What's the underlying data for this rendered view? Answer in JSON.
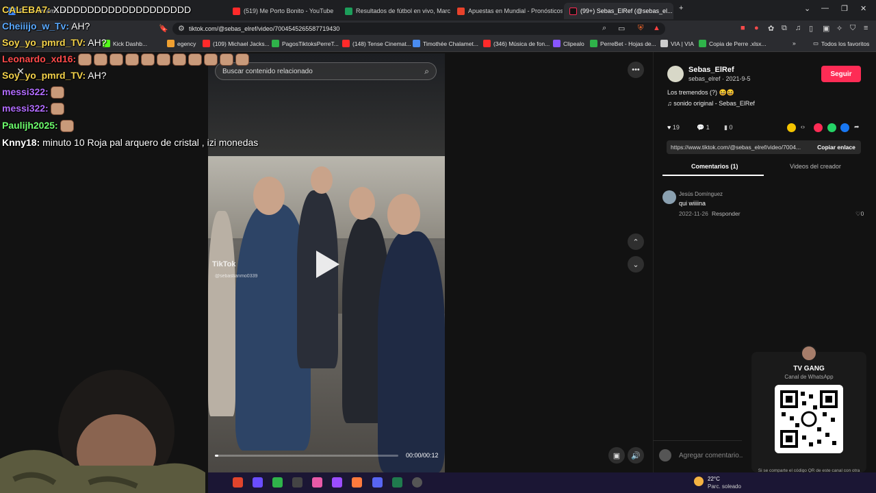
{
  "tabs": [
    {
      "label": "F... re streams Lc",
      "color": "#3f8cff"
    },
    {
      "label": "(519) Me Porto Bonito - YouTube",
      "color": "#ff2a2a"
    },
    {
      "label": "Resultados de fútbol en vivo, Marcad",
      "color": "#1c9e5a"
    },
    {
      "label": "Apuestas en Mundial - Pronósticos d",
      "color": "#e8422b"
    },
    {
      "label": "(99+) Sebas_ElRef (@sebas_el...",
      "color": "#ffffff"
    }
  ],
  "address": {
    "url": "tiktok.com/@sebas_elref/video/7004545265587719430"
  },
  "bookmarks": [
    {
      "label": "Kick Dashb...",
      "color": "#53fc18"
    },
    {
      "label": "egency",
      "color": "#f0a030"
    },
    {
      "label": "(109) Michael Jacks...",
      "color": "#ff2a2a"
    },
    {
      "label": "PagosTiktoksPerreT...",
      "color": "#2fb34a"
    },
    {
      "label": "(148) Tense Cinemat...",
      "color": "#ff2a2a"
    },
    {
      "label": "Timothée Chalamet...",
      "color": "#4a8cf0"
    },
    {
      "label": "(346) Música de fon...",
      "color": "#ff2a2a"
    },
    {
      "label": "Clipealo",
      "color": "#8855ff"
    },
    {
      "label": "PerreBet - Hojas de...",
      "color": "#2fb34a"
    },
    {
      "label": "VIA | VIA",
      "color": "#cccccc"
    },
    {
      "label": "Copia de Perre .xlsx...",
      "color": "#2fb34a"
    },
    {
      "label": "Todos los favoritos",
      "color": "#cccccc"
    }
  ],
  "chat": [
    {
      "user": "CALEBA7:",
      "color": "#f3d24a",
      "msg": " XDDDDDDDDDDDDDDDDDDD",
      "emotes": 0
    },
    {
      "user": "Cheiiijo_w_Tv:",
      "color": "#5aa9ff",
      "msg": " AH?",
      "emotes": 0
    },
    {
      "user": "Soy_yo_pmrd_TV:",
      "color": "#f3d24a",
      "msg": " AH?",
      "emotes": 0
    },
    {
      "user": "Leonardo_xd16:",
      "color": "#ff4a4a",
      "msg": "",
      "emotes": 11
    },
    {
      "user": "Soy_yo_pmrd_TV:",
      "color": "#f3d24a",
      "msg": " AH?",
      "emotes": 0
    },
    {
      "user": "messi322:",
      "color": "#b26cff",
      "msg": "",
      "emotes": 1
    },
    {
      "user": "messi322:",
      "color": "#b26cff",
      "msg": "",
      "emotes": 1
    },
    {
      "user": "Paulijh2025:",
      "color": "#6dff6d",
      "msg": "",
      "emotes": 1
    },
    {
      "user": "Knny18:",
      "color": "#ffffff",
      "msg": " minuto 10 Roja pal arquero de cristal , izi monedas",
      "emotes": 0
    }
  ],
  "video": {
    "search_placeholder": "Buscar contenido relacionado",
    "watermark": "TikTok",
    "watermark_user": "@sebastianmo0339",
    "time": "00:00/00:12",
    "progress": 0.02
  },
  "creator": {
    "name": "Sebas_ElRef",
    "handle_date": "sebas_elref · 2021-9-5",
    "follow_label": "Seguir",
    "caption": "Los tremendos (?) 😆😆",
    "sound": "sonido original - Sebas_ElRef",
    "likes": "19",
    "comments": "1",
    "saves": "0",
    "link": "https://www.tiktok.com/@sebas_elref/video/7004...",
    "copy_label": "Copiar enlace"
  },
  "comment_tabs": {
    "comments": "Comentarios (1)",
    "videos": "Videos del creador"
  },
  "comments": [
    {
      "author": "Jesús Domínguez",
      "text": "qui wiiiina",
      "date": "2022-11-26",
      "reply": "Responder",
      "likes": "0"
    }
  ],
  "add_comment_placeholder": "Agregar comentario...",
  "whatsapp": {
    "title": "TV GANG",
    "subtitle": "Canal de WhatsApp",
    "note": "Si se comparte el código QR de este canal con otra persona, esta podrá escanearlo con su cámara para ver y seguir tu canal."
  },
  "weather": {
    "temp": "22°C",
    "desc": "Parc. soleado"
  }
}
